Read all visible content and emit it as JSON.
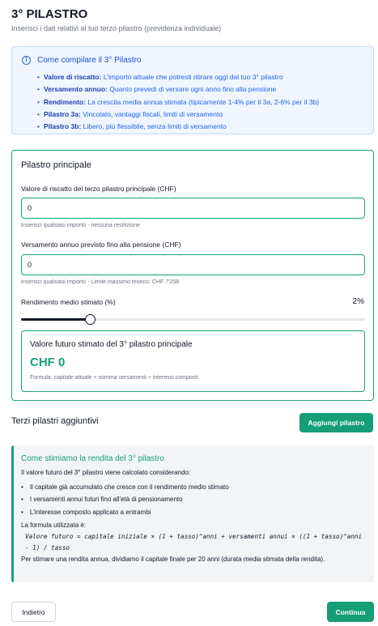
{
  "header": {
    "title": "3° PILASTRO",
    "subtitle": "Inserisci i dati relativi al tuo terzo pilastro (previdenza individuale)"
  },
  "info": {
    "icon": "info-icon",
    "title": "Come compilare il 3° Pilastro",
    "items": [
      {
        "term": "Valore di riscatto:",
        "text": " L'importo attuale che potresti ritirare oggi dal tuo 3° pilastro"
      },
      {
        "term": "Versamento annuo:",
        "text": " Quanto prevedi di versare ogni anno fino alla pensione"
      },
      {
        "term": "Rendimento:",
        "text": " La crescita media annua stimata (tipicamente 1-4% per il 3a, 2-6% per il 3b)"
      },
      {
        "term": "Pilastro 3a:",
        "text": " Vincolato, vantaggi fiscali, limiti di versamento"
      },
      {
        "term": "Pilastro 3b:",
        "text": " Libero, più flessibile, senza limiti di versamento"
      }
    ]
  },
  "main_pillar": {
    "title": "Pilastro principale",
    "surrender_label": "Valore di riscatto del terzo pilastro principale (CHF)",
    "surrender_value": "0",
    "surrender_hint": "Inserisci qualsiasi importo - nessuna restrizione",
    "contribution_label": "Versamento annuo previsto fino alla pensione (CHF)",
    "contribution_value": "0",
    "contribution_hint": "Inserisci qualsiasi importo - Limite massimo teorico: CHF 7'258",
    "return_label": "Rendimento medio stimato (%)",
    "return_display": "2%",
    "return_slider_fraction": 0.2,
    "future_title": "Valore futuro stimato del 3° pilastro principale",
    "future_value": "CHF 0",
    "future_formula": "Formula: capitale attuale + somma versamenti + interessi composti"
  },
  "additional": {
    "title": "Terzi pilastri aggiuntivi",
    "add_button": "Aggiungi pilastro"
  },
  "estimate": {
    "title": "Come stimiamo la rendita del 3° pilastro",
    "intro": "Il valore futuro del 3° pilastro viene calcolato considerando:",
    "items": [
      "Il capitale già accumulato che cresce con il rendimento medio stimato",
      "I versamenti annui futuri fino all'età di pensionamento",
      "L'interesse composto applicato a entrambi"
    ],
    "formula_label": "La formula utilizzata è:",
    "formula": "Valore futuro = capitale iniziale × (1 + tasso)^anni + versamenti annui × ((1 + tasso)^anni - 1) / tasso",
    "footer": "Per stimare una rendita annua, dividiamo il capitale finale per 20 anni (durata media stimata della rendita)."
  },
  "footer": {
    "back": "Indietro",
    "next": "Continua"
  },
  "colors": {
    "accent": "#169e77",
    "info_bg": "#eff6ff",
    "info_text": "#2563eb"
  }
}
